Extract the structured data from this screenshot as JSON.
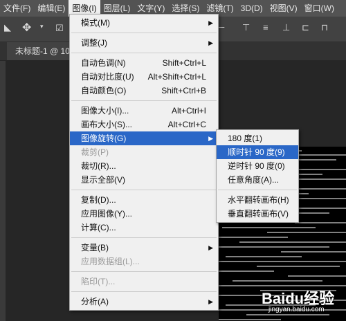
{
  "menubar": [
    "文件(F)",
    "编辑(E)",
    "图像(I)",
    "图层(L)",
    "文字(Y)",
    "选择(S)",
    "滤镜(T)",
    "3D(D)",
    "视图(V)",
    "窗口(W)"
  ],
  "doc_tab": "未标题-1 @ 10",
  "image_menu": {
    "mode": "模式(M)",
    "adjustments": "调整(J)",
    "auto_tone": {
      "label": "自动色调(N)",
      "shortcut": "Shift+Ctrl+L"
    },
    "auto_contrast": {
      "label": "自动对比度(U)",
      "shortcut": "Alt+Shift+Ctrl+L"
    },
    "auto_color": {
      "label": "自动颜色(O)",
      "shortcut": "Shift+Ctrl+B"
    },
    "image_size": {
      "label": "图像大小(I)...",
      "shortcut": "Alt+Ctrl+I"
    },
    "canvas_size": {
      "label": "画布大小(S)...",
      "shortcut": "Alt+Ctrl+C"
    },
    "image_rotation": "图像旋转(G)",
    "crop": "裁剪(P)",
    "trim": "裁切(R)...",
    "reveal_all": "显示全部(V)",
    "duplicate": "复制(D)...",
    "apply_image": "应用图像(Y)...",
    "calculations": "计算(C)...",
    "variables": "变量(B)",
    "apply_data_set": "应用数据组(L)...",
    "trap": "陷印(T)...",
    "analysis": "分析(A)"
  },
  "rotation_submenu": [
    "180 度(1)",
    "顺时针 90 度(9)",
    "逆时针 90 度(0)",
    "任意角度(A)...",
    "水平翻转画布(H)",
    "垂直翻转画布(V)"
  ],
  "watermark": {
    "text": "Baidu经验",
    "url": "jingyan.baidu.com"
  }
}
